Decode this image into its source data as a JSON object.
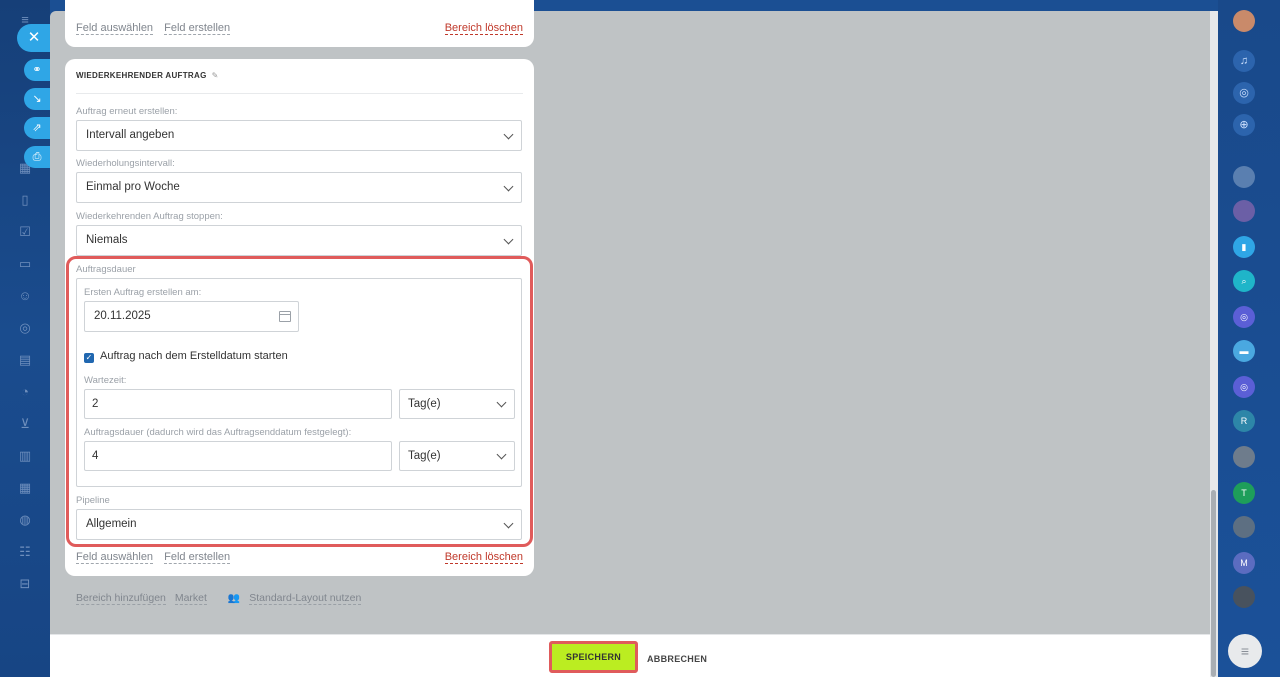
{
  "top_card": {
    "select_field": "Feld auswählen",
    "create_field": "Feld erstellen",
    "delete_section": "Bereich löschen"
  },
  "section": {
    "title": "WIEDERKEHRENDER AUFTRAG",
    "recreate_label": "Auftrag erneut erstellen:",
    "recreate_value": "Intervall angeben",
    "interval_label": "Wiederholungsintervall:",
    "interval_value": "Einmal pro Woche",
    "stop_label": "Wiederkehrenden Auftrag stoppen:",
    "stop_value": "Niemals",
    "duration_group_label": "Auftragsdauer",
    "first_order_label": "Ersten Auftrag erstellen am:",
    "first_order_date": "20.11.2025",
    "start_after_label": "Auftrag nach dem Erstelldatum starten",
    "start_after_checked": true,
    "wait_label": "Wartezeit:",
    "wait_value": "2",
    "wait_unit": "Tag(e)",
    "duration_label": "Auftragsdauer (dadurch wird das Auftragsenddatum festgelegt):",
    "duration_value": "4",
    "duration_unit": "Tag(e)",
    "pipeline_label": "Pipeline",
    "pipeline_value": "Allgemein",
    "select_field": "Feld auswählen",
    "create_field": "Feld erstellen",
    "delete_section": "Bereich löschen"
  },
  "bottom_links": {
    "add_section": "Bereich hinzufügen",
    "market": "Market",
    "standard_layout": "Standard-Layout nutzen"
  },
  "footer": {
    "save": "SPEICHERN",
    "cancel": "ABBRECHEN"
  },
  "right_rail_letters": [
    "R",
    "T",
    "M"
  ],
  "colors": {
    "save_button": "#bbed21",
    "highlight": "#e05b5b",
    "delete_link": "#c0392b",
    "rail": "#1b4f93"
  }
}
